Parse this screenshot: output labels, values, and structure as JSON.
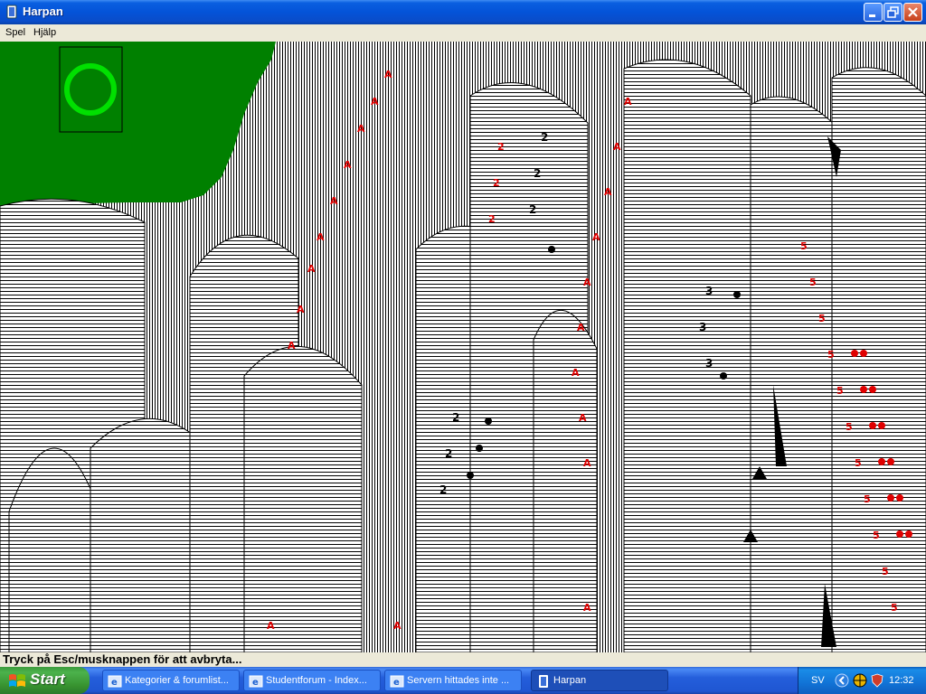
{
  "window": {
    "title": "Harpan",
    "icon": "solitaire-card-icon",
    "controls": [
      "minimize",
      "maximize",
      "close"
    ]
  },
  "menubar": {
    "items": [
      {
        "label": "Spel"
      },
      {
        "label": "Hjälp"
      }
    ]
  },
  "game": {
    "background_color": "#008000",
    "card_placeholder": {
      "icon": "recycle-circle-icon",
      "color": "#00e000"
    }
  },
  "statusbar": {
    "text": "Tryck på Esc/musknappen för att avbryta..."
  },
  "taskbar": {
    "start_label": "Start",
    "tasks": [
      {
        "label": "Kategorier & forumlist...",
        "icon": "ie-icon",
        "active": false
      },
      {
        "label": "Studentforum - Index...",
        "icon": "ie-icon",
        "active": false
      },
      {
        "label": "Servern hittades inte ...",
        "icon": "ie-icon",
        "active": false
      },
      {
        "label": "Harpan",
        "icon": "solitaire-card-icon",
        "active": true
      }
    ],
    "tray": {
      "language": "SV",
      "clock": "12:32",
      "icons": [
        "chevron-left-icon",
        "network-icon",
        "shield-icon"
      ]
    }
  }
}
